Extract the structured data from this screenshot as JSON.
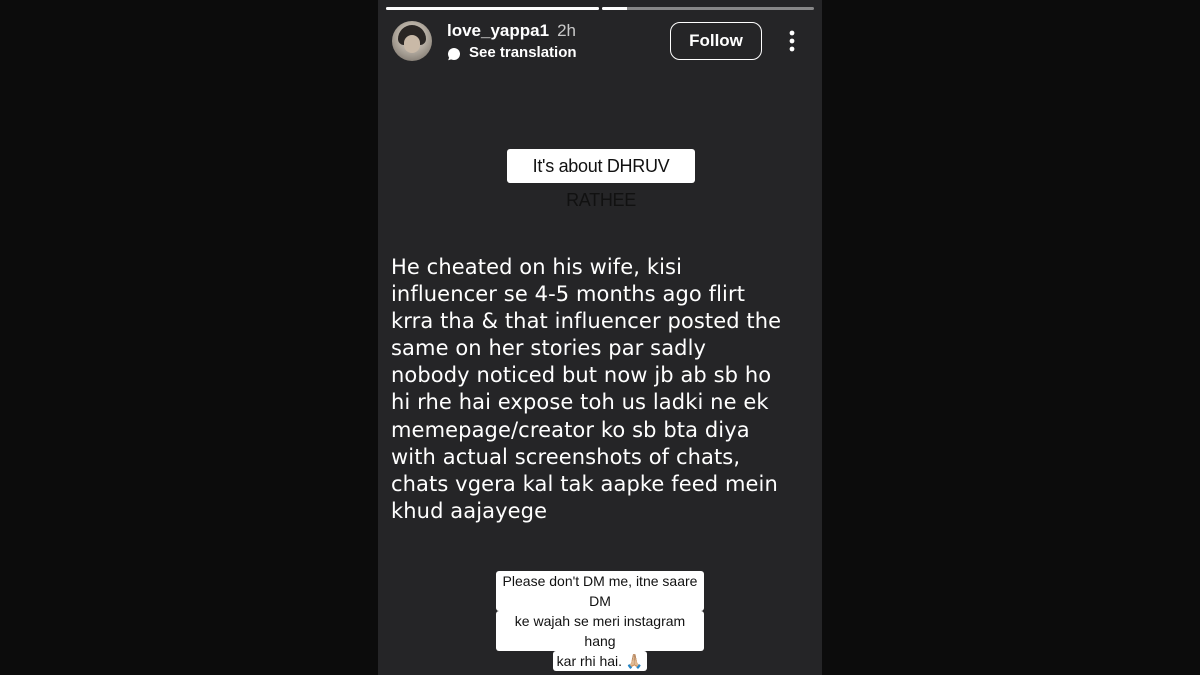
{
  "story": {
    "progress_segments": [
      {
        "fill": 1.0
      },
      {
        "fill": 0.12
      }
    ],
    "header": {
      "username": "love_yappa1",
      "time_ago": "2h",
      "translation_label": "See translation",
      "follow_label": "Follow",
      "more_icon": "more-vertical-icon"
    },
    "top_sticker": "It's about DHRUV RATHEE",
    "body_text": "He cheated on his wife, kisi\ninfluencer se 4-5 months ago flirt\nkrra tha & that influencer posted the\nsame on her stories par sadly\nnobody noticed but now jb ab sb ho\nhi rhe hai expose toh us ladki ne ek\nmemepage/creator ko sb bta diya\nwith actual screenshots of chats,\nchats vgera kal tak aapke feed mein\nkhud aajayege",
    "bottom_sticker_lines": [
      "Please don't DM me, itne saare DM",
      "ke wajah se meri instagram hang",
      "kar rhi hai. 🙏🏼"
    ]
  },
  "colors": {
    "story_background": "#252527",
    "page_background": "#0c0c0c",
    "text": "#ffffff",
    "sticker_background": "#ffffff"
  }
}
